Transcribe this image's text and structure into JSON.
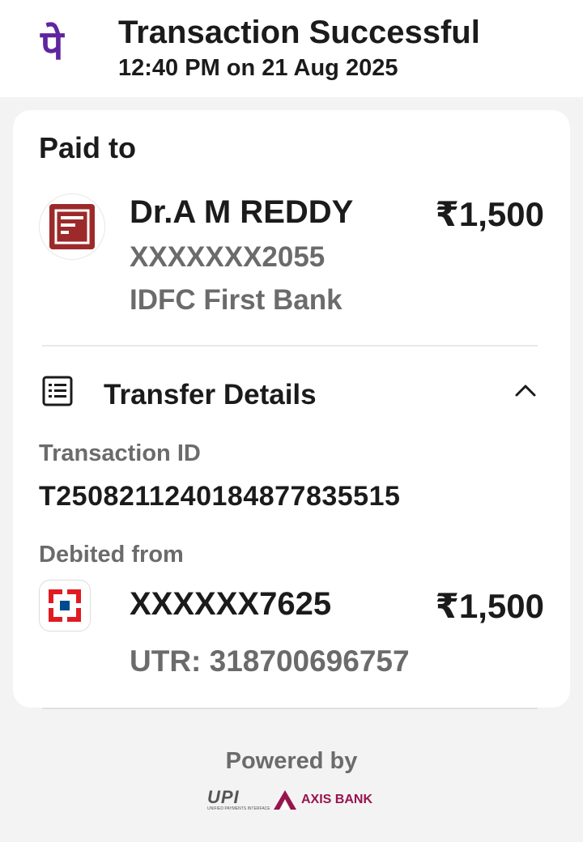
{
  "header": {
    "title": "Transaction Successful",
    "subtitle": "12:40 PM on 21 Aug 2025",
    "logo_glyph": "पे",
    "brand_color": "#5f259f"
  },
  "paid_to": {
    "label": "Paid to",
    "name": "Dr.A M REDDY",
    "amount": "₹1,500",
    "account": "XXXXXXX2055",
    "bank": "IDFC First Bank",
    "avatar_icon": "bank-icon",
    "avatar_color": "#9c2a2a"
  },
  "transfer_details": {
    "title": "Transfer Details",
    "icon": "receipt-list-icon",
    "toggle_icon": "chevron-up-icon",
    "transaction_id_label": "Transaction ID",
    "transaction_id": "T2508211240184877835515",
    "debited_from_label": "Debited from",
    "debit_account": "XXXXXX7625",
    "debit_amount": "₹1,500",
    "utr": "UTR: 318700696757",
    "bank_logo_icon": "hdfc-bank-icon",
    "bank_logo_colors": [
      "#e11b22",
      "#004c8f"
    ]
  },
  "footer": {
    "powered_by": "Powered by",
    "upi_logo_text": "UPI",
    "upi_logo_subtext": "UNIFIED PAYMENTS INTERFACE",
    "partner_bank": "AXIS BANK",
    "partner_color": "#97144d"
  }
}
